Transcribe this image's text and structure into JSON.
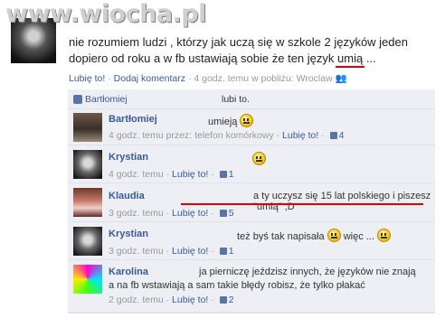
{
  "watermark": "www.wiocha.pl",
  "post": {
    "line1": "nie rozumiem ludzi , którzy jak uczą się w szkole 2 języków jeden",
    "line2_prefix": "dopiero od roku a w fb ustawiają sobie że ten język",
    "line2_word": "umią",
    "line2_suffix": " ...",
    "like_link": "Lubię to!",
    "comment_link": "Dodaj komentarz",
    "time": "4 godz. temu w pobliżu: Wroclaw",
    "sep": "·"
  },
  "likes": {
    "name": "Bartłomiej",
    "text": "lubi to."
  },
  "comments": [
    {
      "name": "Bartłomiej",
      "text": "umieją",
      "time": "4 godz. temu przez: telefon komórkowy",
      "like": "Lubię to!",
      "count": "4"
    },
    {
      "name": "Krystian",
      "text": "",
      "time": "4 godz. temu",
      "like": "Lubię to!",
      "count": "1"
    },
    {
      "name": "Klaudia",
      "text": "a ty uczysz się 15 lat polskiego i piszesz \"umią\" ;D",
      "time": "3 godz. temu",
      "like": "Lubię to!",
      "count": "5"
    },
    {
      "name": "Krystian",
      "text": "też byś tak napisała",
      "text2": "więc ...",
      "time": "3 godz. temu",
      "like": "Lubię to!",
      "count": "1"
    },
    {
      "name": "Karolina",
      "text": "ja pierniczę jeździsz innych, że języków nie znają",
      "text2": "a na fb wstawiają a sam takie błędy robisz, że tylko płakać",
      "time": "2 godz. temu",
      "like": "Lubię to!",
      "count": "2"
    }
  ]
}
